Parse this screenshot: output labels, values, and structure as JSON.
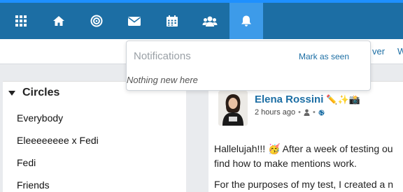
{
  "nav": {
    "items": [
      {
        "icon": "apps-grid-icon"
      },
      {
        "icon": "home-icon"
      },
      {
        "icon": "target-icon"
      },
      {
        "icon": "envelope-icon"
      },
      {
        "icon": "calendar-icon"
      },
      {
        "icon": "users-icon"
      },
      {
        "icon": "bell-icon",
        "active": true
      }
    ]
  },
  "subbar": {
    "link_partial_1": "ver",
    "link_partial_2": "W"
  },
  "notifications": {
    "title": "Notifications",
    "mark_seen": "Mark as seen",
    "empty": "Nothing new here"
  },
  "sidebar": {
    "heading": "Circles",
    "items": [
      "Everybody",
      "Eleeeeeeee x Fedi",
      "Fedi",
      "Friends"
    ]
  },
  "post": {
    "author": "Elena Rossini",
    "author_emojis": "✏️✨📸",
    "time": "2 hours ago",
    "body": [
      "Hallelujah!!! 🥳 After a week of testing ou",
      "find how to make mentions work.",
      "For the purposes of my test, I created a n"
    ]
  },
  "colors": {
    "nav_bg": "#1c6ea4",
    "nav_active": "#3d9be9",
    "link": "#1c6ea4"
  }
}
